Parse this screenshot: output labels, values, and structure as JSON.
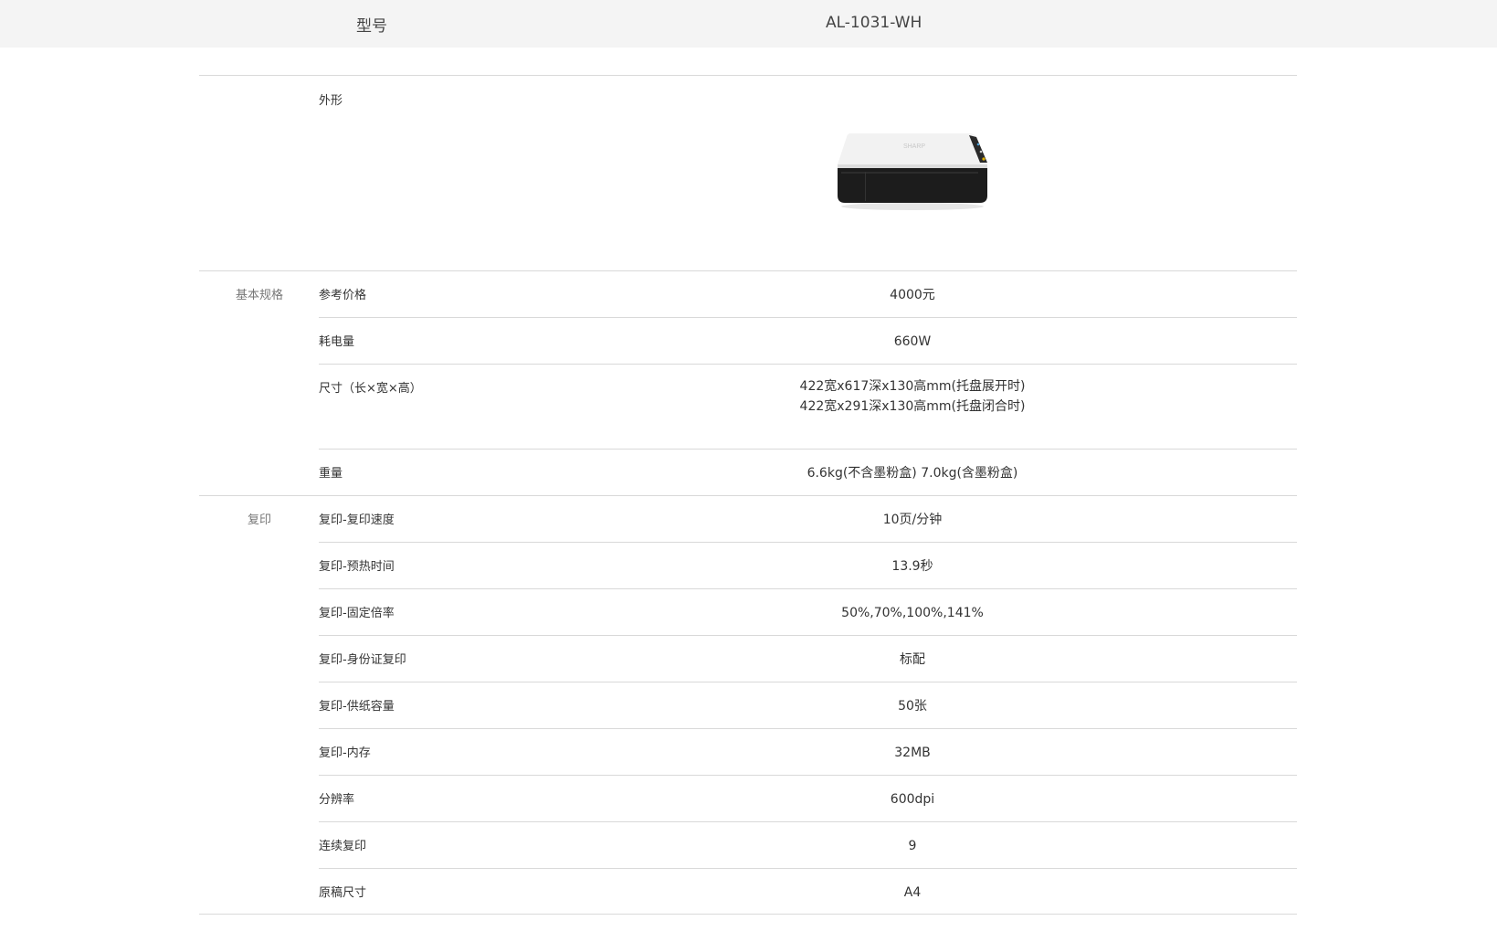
{
  "header": {
    "label": "型号",
    "model": "AL-1031-WH"
  },
  "appearance": {
    "label": "外形",
    "image_icon": "printer-image",
    "brand_mark": "SHARP"
  },
  "groups": {
    "basic": {
      "label": "基本规格",
      "rows": [
        {
          "label": "参考价格",
          "value": "4000元"
        },
        {
          "label": "耗电量",
          "value": "660W"
        },
        {
          "label": "尺寸（长×宽×高）",
          "value": "422宽x617深x130高mm(托盘展开时) 422宽x291深x130高mm(托盘闭合时)"
        },
        {
          "label": "重量",
          "value": "6.6kg(不含墨粉盒) 7.0kg(含墨粉盒)"
        }
      ]
    },
    "copy": {
      "label": "复印",
      "rows": [
        {
          "label": "复印-复印速度",
          "value": "10页/分钟"
        },
        {
          "label": "复印-预热时间",
          "value": "13.9秒"
        },
        {
          "label": "复印-固定倍率",
          "value": "50%,70%,100%,141%"
        },
        {
          "label": "复印-身份证复印",
          "value": "标配"
        },
        {
          "label": "复印-供纸容量",
          "value": "50张"
        },
        {
          "label": "复印-内存",
          "value": "32MB"
        },
        {
          "label": "分辨率",
          "value": "600dpi"
        },
        {
          "label": "连续复印",
          "value": "9"
        },
        {
          "label": "原稿尺寸",
          "value": "A4"
        }
      ]
    }
  }
}
